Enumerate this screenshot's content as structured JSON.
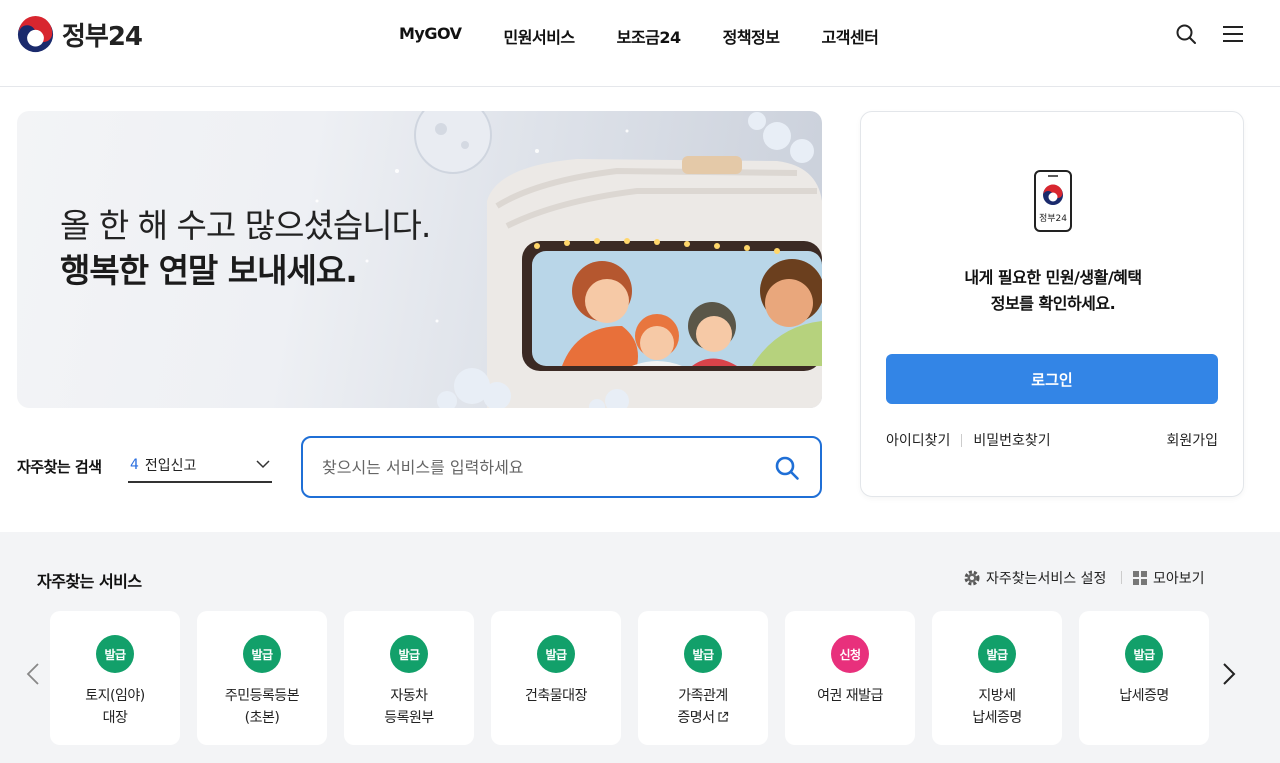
{
  "header": {
    "logo_text": "정부24",
    "nav": [
      "MyGOV",
      "민원서비스",
      "보조금24",
      "정책정보",
      "고객센터"
    ],
    "icons": [
      "search-icon",
      "menu-icon"
    ]
  },
  "banner": {
    "line1": "올 한 해 수고 많으셨습니다.",
    "line2": "행복한 연말 보내세요."
  },
  "search": {
    "fav_label": "자주찾는 검색",
    "fav_rank": "4",
    "fav_term": "전입신고",
    "placeholder": "찾으시는 서비스를 입력하세요"
  },
  "login": {
    "phone_label": "정부24",
    "message_line1": "내게 필요한 민원/생활/혜택",
    "message_line2": "정보를 확인하세요.",
    "button": "로그인",
    "find_id": "아이디찾기",
    "find_pw": "비밀번호찾기",
    "signup": "회원가입"
  },
  "services": {
    "title": "자주찾는 서비스",
    "settings": "자주찾는서비스 설정",
    "view_all": "모아보기",
    "items": [
      {
        "badge": "발급",
        "color": "#12a06a",
        "line1": "토지(임야)",
        "line2": "대장"
      },
      {
        "badge": "발급",
        "color": "#12a06a",
        "line1": "주민등록등본",
        "line2": "(초본)"
      },
      {
        "badge": "발급",
        "color": "#12a06a",
        "line1": "자동차",
        "line2": "등록원부"
      },
      {
        "badge": "발급",
        "color": "#12a06a",
        "line1": "건축물대장",
        "line2": ""
      },
      {
        "badge": "발급",
        "color": "#12a06a",
        "line1": "가족관계",
        "line2": "증명서"
      },
      {
        "badge": "신청",
        "color": "#e8307c",
        "line1": "여권 재발급",
        "line2": ""
      },
      {
        "badge": "발급",
        "color": "#12a06a",
        "line1": "지방세",
        "line2": "납세증명"
      },
      {
        "badge": "발급",
        "color": "#12a06a",
        "line1": "납세증명",
        "line2": ""
      }
    ]
  }
}
